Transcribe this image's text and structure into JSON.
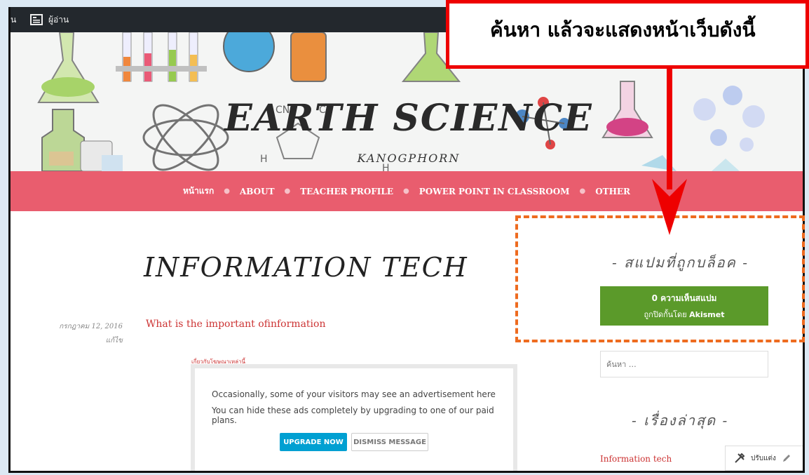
{
  "admin_bar": {
    "left_fragment": "น",
    "reader_label": "ผู้อ่าน"
  },
  "site": {
    "title": "EARTH SCIENCE",
    "description": "KANOGPHORN"
  },
  "nav": {
    "items": [
      "หน้าแรก",
      "ABOUT",
      "TEACHER PROFILE",
      "POWER POINT IN CLASSROOM",
      "OTHER"
    ]
  },
  "post": {
    "title": "INFORMATION TECH",
    "date": "กรกฎาคม 12, 2016",
    "edit": "แก้ไข",
    "link_text": "What is the important ofinformation"
  },
  "ad": {
    "label": "เกี่ยวกับโฆษณาเหล่านี้",
    "line1": "Occasionally, some of your visitors may see an advertisement here",
    "line2": "You can hide these ads completely by upgrading to one of our paid plans.",
    "upgrade": "UPGRADE NOW",
    "dismiss": "DISMISS MESSAGE"
  },
  "sidebar": {
    "spam_title": "- สแปมที่ถูกบล็อค -",
    "akismet_count": "0 ความเห็นสแปม",
    "akismet_by_prefix": "ถูกปิดกั้นโดย ",
    "akismet_brand": "Akismet",
    "search_placeholder": "ค้นหา …",
    "recent_title": "- เรื่องล่าสุด -",
    "recent_item": "Information tech"
  },
  "customize": {
    "label": "ปรับแต่ง"
  },
  "annotation": {
    "callout_text": "ค้นหา แล้วจะแสดงหน้าเว็บดังนี้",
    "colors": {
      "callout_border": "#e00000",
      "arrow": "#ee0000",
      "dashed_box": "#ee6b1f"
    }
  },
  "colors": {
    "nav": "#e95d6e",
    "akismet": "#5b9a2a",
    "link": "#cc3333",
    "upgrade": "#00a0d2"
  }
}
